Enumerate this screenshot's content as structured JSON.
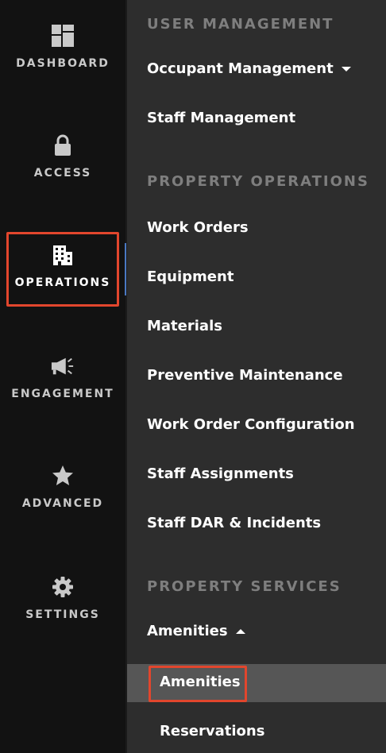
{
  "rail": {
    "items": [
      {
        "label": "DASHBOARD",
        "icon": "dashboard-icon"
      },
      {
        "label": "ACCESS",
        "icon": "lock-icon"
      },
      {
        "label": "OPERATIONS",
        "icon": "building-icon",
        "active": true
      },
      {
        "label": "ENGAGEMENT",
        "icon": "megaphone-icon"
      },
      {
        "label": "ADVANCED",
        "icon": "star-icon"
      },
      {
        "label": "SETTINGS",
        "icon": "gear-icon"
      }
    ]
  },
  "menu": {
    "sections": [
      {
        "title": "USER MANAGEMENT",
        "items": [
          "Occupant Management",
          "Staff Management"
        ]
      },
      {
        "title": "PROPERTY OPERATIONS",
        "items": [
          "Work Orders",
          "Equipment",
          "Materials",
          "Preventive Maintenance",
          "Work Order Configuration",
          "Staff Assignments",
          "Staff DAR & Incidents"
        ]
      },
      {
        "title": "PROPERTY SERVICES",
        "items": [
          "Amenities"
        ],
        "subitems": [
          "Amenities",
          "Reservations"
        ]
      }
    ]
  },
  "colors": {
    "rail_bg": "#121212",
    "panel_bg": "#2d2d2d",
    "section_title": "#7e7e7e",
    "selected_bg": "#565656",
    "highlight_border": "#e2462d",
    "active_indicator": "#4a78c2"
  }
}
